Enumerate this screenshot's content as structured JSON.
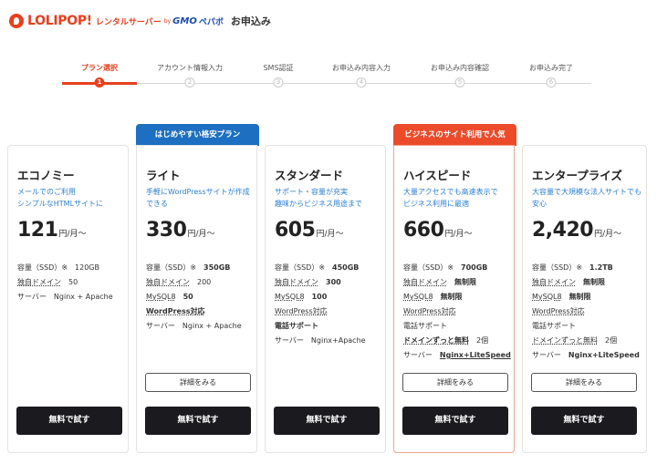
{
  "header": {
    "logo": "LOLIPOP!",
    "logo_sub": "レンタルサーバー",
    "logo_by": "by",
    "logo_gmo": "GMO",
    "logo_pepabo": "ペパボ",
    "title": "お申込み"
  },
  "steps": [
    {
      "label": "プラン選択",
      "num": "1",
      "active": true
    },
    {
      "label": "アカウント情報入力",
      "num": "2",
      "active": false
    },
    {
      "label": "SMS認証",
      "num": "3",
      "active": false
    },
    {
      "label": "お申込み内容入力",
      "num": "4",
      "active": false
    },
    {
      "label": "お申込み内容確認",
      "num": "5",
      "active": false
    },
    {
      "label": "お申込み完了",
      "num": "6",
      "active": false
    }
  ],
  "ribbons": {
    "lite": "はじめやすい格安プラン",
    "highspeed": "ビジネスのサイト利用で人気"
  },
  "common": {
    "detail_label": "詳細をみる",
    "try_label": "無料で試す",
    "price_unit": "円/月〜"
  },
  "plans": [
    {
      "name": "エコノミー",
      "desc": "メールでのご利用\nシンプルなHTMLサイトに",
      "price": "121",
      "specs": {
        "storage_k": "容量（SSD）※",
        "storage_v": "120GB",
        "domain_k": "独自ドメイン",
        "domain_v": "50",
        "server_k": "サーバー",
        "server_v": "Nginx + Apache"
      }
    },
    {
      "name": "ライト",
      "desc": "手軽にWordPressサイトが作成できる",
      "price": "330",
      "specs": {
        "storage_k": "容量（SSD）※",
        "storage_v": "350GB",
        "domain_k": "独自ドメイン",
        "domain_v": "200",
        "mysql_k": "MySQL8",
        "mysql_v": "50",
        "wp": "WordPress対応",
        "server_k": "サーバー",
        "server_v": "Nginx + Apache"
      }
    },
    {
      "name": "スタンダード",
      "desc": "サポート・容量が充実\n趣味からビジネス用途まで",
      "price": "605",
      "specs": {
        "storage_k": "容量（SSD）※",
        "storage_v": "450GB",
        "domain_k": "独自ドメイン",
        "domain_v": "300",
        "mysql_k": "MySQL8",
        "mysql_v": "100",
        "wp": "WordPress対応",
        "phone": "電話サポート",
        "server_k": "サーバー",
        "server_v": "Nginx+Apache"
      }
    },
    {
      "name": "ハイスピード",
      "desc": "大量アクセスでも高速表示で\nビジネス利用に最適",
      "price": "660",
      "specs": {
        "storage_k": "容量（SSD）※",
        "storage_v": "700GB",
        "domain_k": "独自ドメイン",
        "domain_v": "無制限",
        "mysql_k": "MySQL8",
        "mysql_v": "無制限",
        "wp": "WordPress対応",
        "phone": "電話サポート",
        "forever_k": "ドメインずっと無料",
        "forever_v": "2個",
        "server_k": "サーバー",
        "server_v": "Nginx+LiteSpeed"
      }
    },
    {
      "name": "エンタープライズ",
      "desc": "大容量で大規模な法人サイトでも安心",
      "price": "2,420",
      "specs": {
        "storage_k": "容量（SSD）※",
        "storage_v": "1.2TB",
        "domain_k": "独自ドメイン",
        "domain_v": "無制限",
        "mysql_k": "MySQL8",
        "mysql_v": "無制限",
        "wp": "WordPress対応",
        "phone": "電話サポート",
        "forever_k": "ドメインずっと無料",
        "forever_v": "2個",
        "server_k": "サーバー",
        "server_v": "Nginx+LiteSpeed"
      }
    }
  ]
}
